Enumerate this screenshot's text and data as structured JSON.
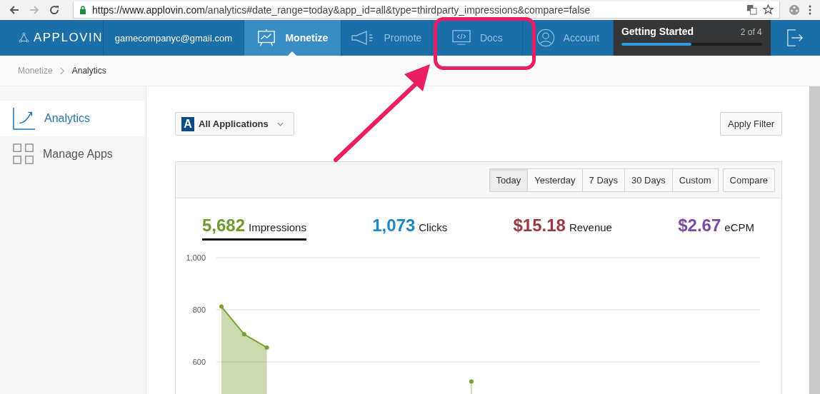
{
  "browser": {
    "url_host": "https://www.applovin.com",
    "url_path": "/analytics#date_range=today&app_id=all&type=thirdparty_impressions&compare=false"
  },
  "nav": {
    "brand_bold": "APP",
    "brand_light": "LOVIN",
    "email": "gamecompanyc@gmail.com",
    "items": [
      {
        "label": "Monetize",
        "selected": true,
        "highlighted": false
      },
      {
        "label": "Promote",
        "selected": false,
        "highlighted": false
      },
      {
        "label": "Docs",
        "selected": false,
        "highlighted": true
      },
      {
        "label": "Account",
        "selected": false,
        "highlighted": false
      }
    ],
    "getting_started": {
      "title": "Getting Started",
      "step": "2 of 4",
      "level": 0.5
    }
  },
  "breadcrumb": [
    {
      "label": "Monetize"
    },
    {
      "label": "Analytics"
    }
  ],
  "sidebar": {
    "items": [
      {
        "label": "Analytics",
        "kind": "chart",
        "selected": true
      },
      {
        "label": "Manage Apps",
        "kind": "grid",
        "selected": false
      }
    ]
  },
  "filter": {
    "app_badge": "A",
    "app_select": "All Applications",
    "apply_button": "Apply Filter"
  },
  "range_buttons": [
    {
      "label": "Today",
      "selected": true
    },
    {
      "label": "Yesterday",
      "selected": false
    },
    {
      "label": "7 Days",
      "selected": false
    },
    {
      "label": "30 Days",
      "selected": false
    },
    {
      "label": "Custom",
      "selected": false
    }
  ],
  "compare_button": "Compare",
  "metrics": [
    {
      "value": "5,682",
      "label": "Impressions",
      "color": "#6e9a2e",
      "selected": true
    },
    {
      "value": "1,073",
      "label": "Clicks",
      "color": "#1f86c8",
      "selected": false
    },
    {
      "value": "$15.18",
      "label": "Revenue",
      "color": "#9e3a3f",
      "selected": false
    },
    {
      "value": "$2.67",
      "label": "eCPM",
      "color": "#7c4aa0",
      "selected": false
    }
  ],
  "chart_data": {
    "type": "area",
    "ylim": [
      0,
      1000
    ],
    "yticks": [
      {
        "value": 600,
        "label": "600"
      },
      {
        "value": 800,
        "label": "800"
      },
      {
        "value": 1000,
        "label": "1,000"
      }
    ],
    "series": [
      {
        "color": "#7a9f35",
        "values": [
          812,
          706,
          655,
          null,
          null,
          null,
          null,
          null,
          null,
          null,
          null,
          525,
          null,
          null,
          null,
          null,
          null,
          null,
          null,
          null,
          null,
          null,
          null,
          null
        ]
      }
    ]
  }
}
